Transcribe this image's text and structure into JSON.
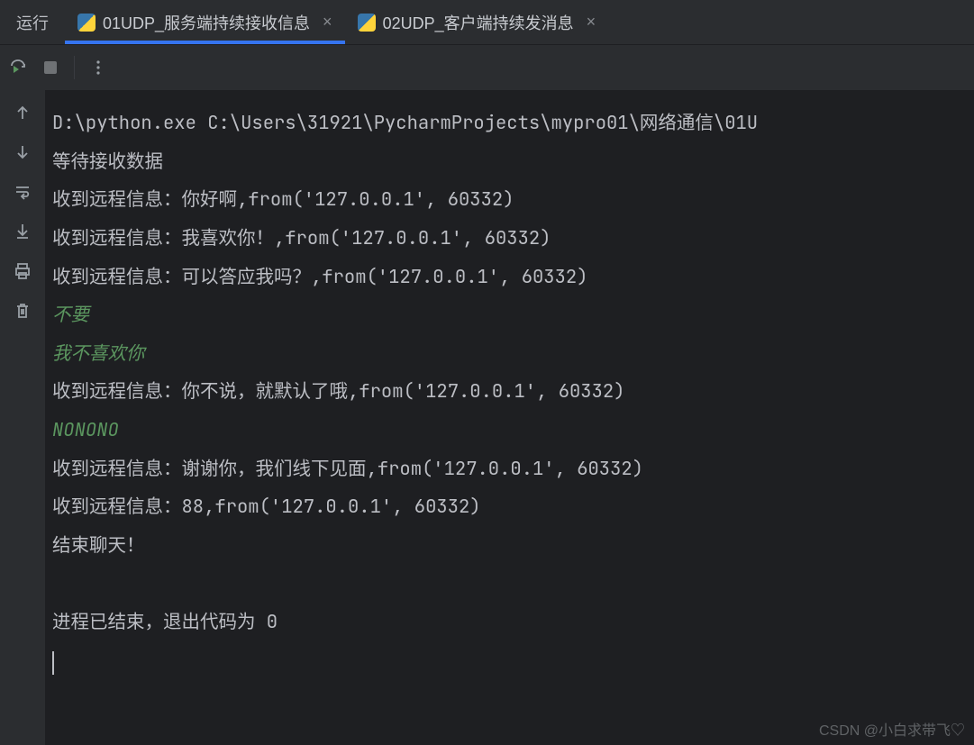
{
  "tabBar": {
    "runLabel": "运行",
    "tabs": [
      {
        "label": "01UDP_服务端持续接收信息",
        "active": true
      },
      {
        "label": "02UDP_客户端持续发消息",
        "active": false
      }
    ]
  },
  "console": {
    "lines": [
      {
        "text": "D:\\python.exe C:\\Users\\31921\\PycharmProjects\\mypro01\\网络通信\\01U",
        "type": "normal"
      },
      {
        "text": "等待接收数据",
        "type": "normal"
      },
      {
        "text": "收到远程信息：你好啊,from('127.0.0.1', 60332)",
        "type": "normal"
      },
      {
        "text": "收到远程信息：我喜欢你！,from('127.0.0.1', 60332)",
        "type": "normal"
      },
      {
        "text": "收到远程信息：可以答应我吗？,from('127.0.0.1', 60332)",
        "type": "normal"
      },
      {
        "text": "不要",
        "type": "input"
      },
      {
        "text": "我不喜欢你",
        "type": "input"
      },
      {
        "text": "收到远程信息：你不说，就默认了哦,from('127.0.0.1', 60332)",
        "type": "normal"
      },
      {
        "text": "NONONO",
        "type": "input"
      },
      {
        "text": "收到远程信息：谢谢你，我们线下见面,from('127.0.0.1', 60332)",
        "type": "normal"
      },
      {
        "text": "收到远程信息：88,from('127.0.0.1', 60332)",
        "type": "normal"
      },
      {
        "text": "结束聊天！",
        "type": "normal"
      },
      {
        "text": "",
        "type": "normal"
      },
      {
        "text": "进程已结束，退出代码为 0",
        "type": "normal"
      }
    ]
  },
  "watermark": "CSDN @小白求带飞♡"
}
